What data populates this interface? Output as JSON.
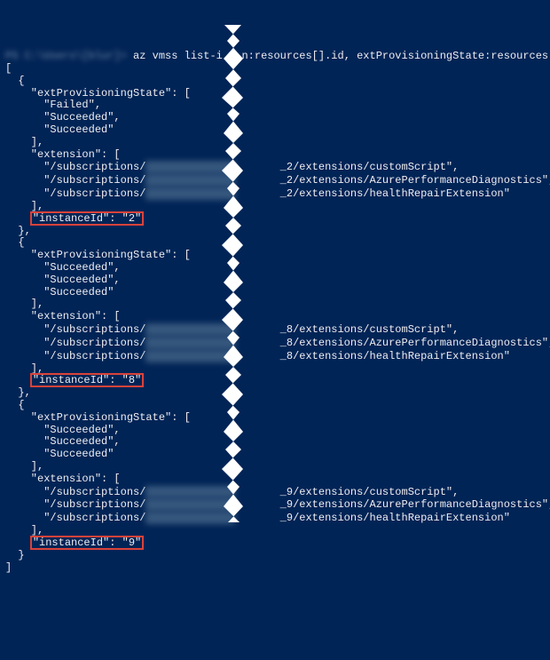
{
  "command": {
    "prompt_obscured": "PS C:\\Users\\[blur]> ",
    "visible_left": "az vmss list-i",
    "visible_right": "n:resources[].id, extProvisioningState:resources[]"
  },
  "smudge_spacer": "xxxxxxxxxxxxxx",
  "instances": [
    {
      "states": [
        "Failed",
        "Succeeded",
        "Succeeded"
      ],
      "suffix_id": "_2",
      "exts": [
        "customScript",
        "AzurePerformanceDiagnostics",
        "healthRepairExtension"
      ],
      "instanceId": "2"
    },
    {
      "states": [
        "Succeeded",
        "Succeeded",
        "Succeeded"
      ],
      "suffix_id": "_8",
      "exts": [
        "customScript",
        "AzurePerformanceDiagnostics",
        "healthRepairExtension"
      ],
      "instanceId": "8"
    },
    {
      "states": [
        "Succeeded",
        "Succeeded",
        "Succeeded"
      ],
      "suffix_id": "_9",
      "exts": [
        "customScript",
        "AzurePerformanceDiagnostics",
        "healthRepairExtension"
      ],
      "instanceId": "9"
    }
  ],
  "labels": {
    "extProvisioningState": "extProvisioningState",
    "extension": "extension",
    "subscriptions": "/subscriptions/",
    "extensions": "/extensions/",
    "instanceId": "instanceId"
  }
}
